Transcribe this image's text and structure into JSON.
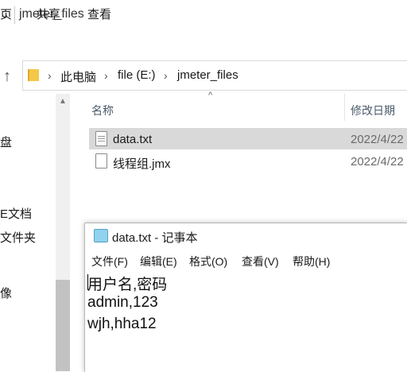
{
  "explorer": {
    "title": "jmeter_files",
    "title_chevron": "⌄",
    "ribbon_tabs": [
      "页",
      "共享",
      "查看"
    ],
    "address": {
      "crumbs": [
        "此电脑",
        "file (E:)",
        "jmeter_files"
      ],
      "separator": "›"
    },
    "nav_items": [
      "盘",
      "E文档",
      "文件夹",
      "像"
    ],
    "columns": {
      "name": "名称",
      "date": "修改日期"
    },
    "files": [
      {
        "name": "data.txt",
        "date": "2022/4/22",
        "selected": true
      },
      {
        "name": "线程组.jmx",
        "date": "2022/4/22",
        "selected": false
      }
    ]
  },
  "notepad": {
    "title": "data.txt - 记事本",
    "menu": [
      "文件(F)",
      "编辑(E)",
      "格式(O)",
      "查看(V)",
      "帮助(H)"
    ],
    "lines": [
      "用户名,密码",
      "admin,123",
      "wjh,hha12"
    ]
  },
  "colors": {
    "selection": "#d9d9d9",
    "folder": "#f4c84a",
    "scroll_thumb": "#c2c2c2"
  }
}
